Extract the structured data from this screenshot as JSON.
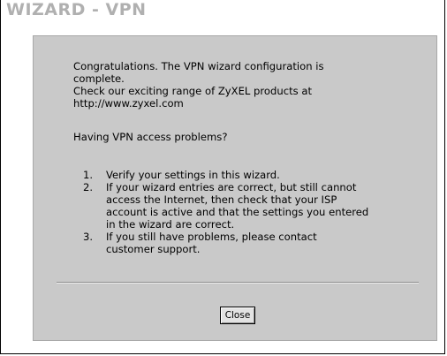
{
  "window": {
    "title": "WIZARD - VPN"
  },
  "message": {
    "line1": "Congratulations. The VPN wizard configuration is",
    "line2": "complete.",
    "line3": "Check our exciting range of ZyXEL products at",
    "line4": "http://www.zyxel.com"
  },
  "troubleshoot": {
    "heading": "Having VPN access problems?",
    "items": [
      {
        "num": "1.",
        "text": "Verify your settings in this wizard."
      },
      {
        "num": "2.",
        "lines": [
          "If your wizard entries are correct, but still cannot",
          "access the Internet, then check that your ISP",
          "account is active and that the settings you entered",
          "in the wizard are correct."
        ]
      },
      {
        "num": "3.",
        "lines": [
          "If you still have problems, please contact",
          "customer support."
        ]
      }
    ]
  },
  "buttons": {
    "close_label": "Close"
  }
}
